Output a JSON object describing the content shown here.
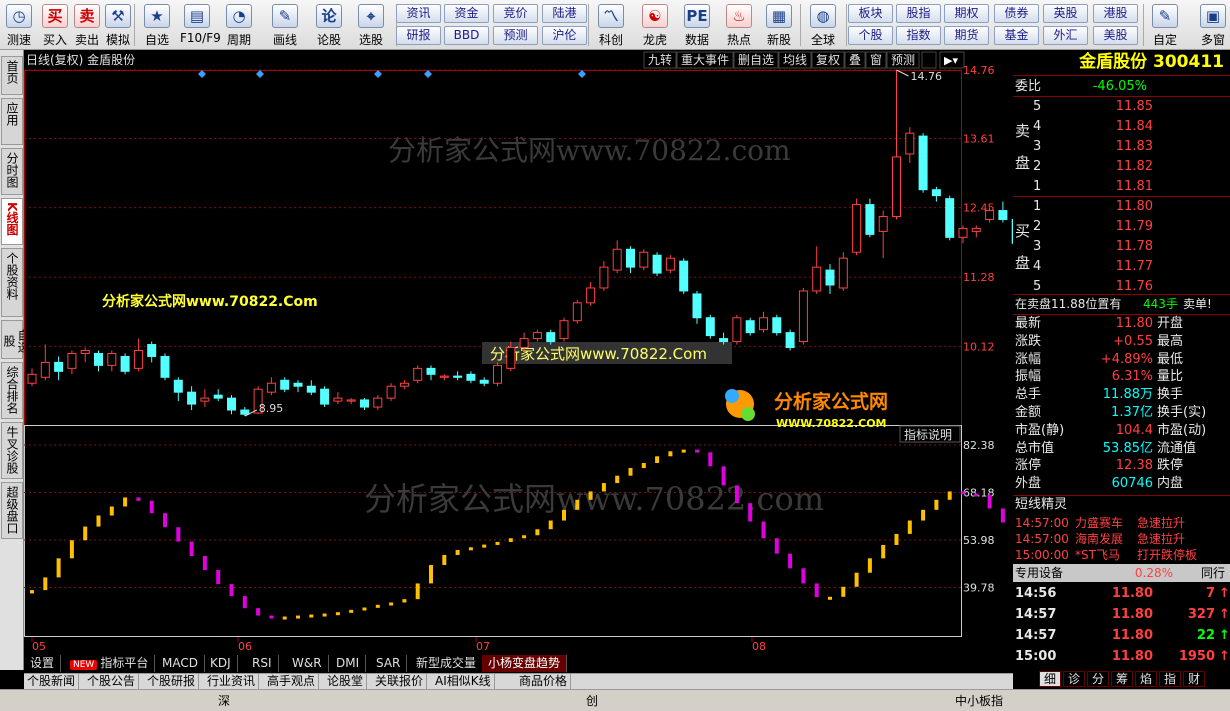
{
  "toolbar": {
    "items": [
      {
        "label": "测速",
        "icon": "clock-icon",
        "glyph": "◷"
      },
      {
        "label": "买入",
        "icon": "buy-icon",
        "glyph": "买"
      },
      {
        "label": "卖出",
        "icon": "sell-icon",
        "glyph": "卖"
      },
      {
        "label": "模拟",
        "icon": "hammer-icon",
        "glyph": "⚒"
      },
      {
        "label": "自选",
        "icon": "star-icon",
        "glyph": "★"
      },
      {
        "label": "F10/F9",
        "icon": "f10-icon",
        "glyph": "▤"
      },
      {
        "label": "周期",
        "icon": "period-icon",
        "glyph": "◔"
      },
      {
        "label": "画线",
        "icon": "pen-icon",
        "glyph": "✎"
      },
      {
        "label": "论股",
        "icon": "discuss-icon",
        "glyph": "论"
      },
      {
        "label": "选股",
        "icon": "stock-pick-icon",
        "glyph": "⌖"
      },
      {
        "label": "科创",
        "icon": "kechuang-icon",
        "glyph": "〽"
      },
      {
        "label": "龙虎",
        "icon": "dragon-icon",
        "glyph": "☯"
      },
      {
        "label": "数据",
        "icon": "pe-icon",
        "glyph": "PE"
      },
      {
        "label": "热点",
        "icon": "hot-icon",
        "glyph": "♨"
      },
      {
        "label": "新股",
        "icon": "new-stock-icon",
        "glyph": "▦"
      },
      {
        "label": "全球",
        "icon": "globe-icon",
        "glyph": "◍"
      },
      {
        "label": "自定",
        "icon": "custom-icon",
        "glyph": "✎"
      },
      {
        "label": "多窗",
        "icon": "multiwindow-icon",
        "glyph": "▣"
      }
    ],
    "buttons_top": [
      "资讯",
      "资金",
      "竞价",
      "陆港",
      "板块",
      "股指",
      "期权",
      "债券",
      "英股",
      "港股"
    ],
    "buttons_bottom": [
      "研报",
      "BBD",
      "预测",
      "沪伦",
      "个股",
      "指数",
      "期货",
      "基金",
      "外汇",
      "美股"
    ]
  },
  "leftnav": [
    "首页",
    "应用",
    "分时图",
    "K线图",
    "个股资料",
    "自选股",
    "综合排名",
    "牛叉诊股",
    "超级盘口"
  ],
  "chart": {
    "title": "日线(复权) 金盾股份",
    "menu": [
      "九转",
      "重大事件",
      "删自选",
      "均线",
      "复权",
      "叠",
      "窗",
      "预测"
    ],
    "price_labels": [
      "14.76",
      "13.61",
      "12.45",
      "11.28",
      "10.12"
    ],
    "high_label": "14.76",
    "low_label": "8.95",
    "indicator_labels": [
      "82.38",
      "68.18",
      "53.98",
      "39.78"
    ],
    "indicator_btn": "指标说明",
    "x_labels": [
      "05",
      "06",
      "07",
      "08"
    ],
    "watermark": "分析家公式网www.70822.com",
    "watermark_yellow": "分析家公式网www.70822.Com",
    "watermark_box": "分析家公式网www.70822.Com",
    "logo_text": "分析家公式网",
    "logo_url": "WWW.70822.COM"
  },
  "chart_data": {
    "type": "candlestick",
    "price_range": [
      8.95,
      14.76
    ],
    "indicator_range": [
      25.58,
      82.38
    ],
    "candles": [
      {
        "o": 9.5,
        "c": 9.65,
        "h": 9.75,
        "l": 9.45
      },
      {
        "o": 9.6,
        "c": 9.85,
        "h": 10.15,
        "l": 9.55
      },
      {
        "o": 9.85,
        "c": 9.7,
        "h": 9.95,
        "l": 9.55
      },
      {
        "o": 9.75,
        "c": 10.0,
        "h": 10.05,
        "l": 9.65
      },
      {
        "o": 10.0,
        "c": 10.05,
        "h": 10.1,
        "l": 9.85
      },
      {
        "o": 10.0,
        "c": 9.8,
        "h": 10.05,
        "l": 9.7
      },
      {
        "o": 9.8,
        "c": 10.0,
        "h": 10.05,
        "l": 9.7
      },
      {
        "o": 9.95,
        "c": 9.7,
        "h": 10.0,
        "l": 9.65
      },
      {
        "o": 9.75,
        "c": 10.05,
        "h": 10.25,
        "l": 9.7
      },
      {
        "o": 10.15,
        "c": 9.95,
        "h": 10.2,
        "l": 9.85
      },
      {
        "o": 9.95,
        "c": 9.6,
        "h": 10.0,
        "l": 9.55
      },
      {
        "o": 9.55,
        "c": 9.35,
        "h": 9.6,
        "l": 9.2
      },
      {
        "o": 9.35,
        "c": 9.15,
        "h": 9.45,
        "l": 9.05
      },
      {
        "o": 9.2,
        "c": 9.25,
        "h": 9.4,
        "l": 9.1
      },
      {
        "o": 9.3,
        "c": 9.25,
        "h": 9.4,
        "l": 9.2
      },
      {
        "o": 9.25,
        "c": 9.05,
        "h": 9.3,
        "l": 8.98
      },
      {
        "o": 9.05,
        "c": 8.98,
        "h": 9.1,
        "l": 8.95
      },
      {
        "o": 9.0,
        "c": 9.4,
        "h": 9.45,
        "l": 8.98
      },
      {
        "o": 9.35,
        "c": 9.5,
        "h": 9.6,
        "l": 9.3
      },
      {
        "o": 9.55,
        "c": 9.4,
        "h": 9.6,
        "l": 9.35
      },
      {
        "o": 9.5,
        "c": 9.45,
        "h": 9.55,
        "l": 9.35
      },
      {
        "o": 9.45,
        "c": 9.35,
        "h": 9.55,
        "l": 9.3
      },
      {
        "o": 9.4,
        "c": 9.15,
        "h": 9.45,
        "l": 9.1
      },
      {
        "o": 9.2,
        "c": 9.25,
        "h": 9.35,
        "l": 9.15
      },
      {
        "o": 9.2,
        "c": 9.22,
        "h": 9.25,
        "l": 9.15
      },
      {
        "o": 9.22,
        "c": 9.1,
        "h": 9.25,
        "l": 9.05
      },
      {
        "o": 9.1,
        "c": 9.25,
        "h": 9.3,
        "l": 9.05
      },
      {
        "o": 9.25,
        "c": 9.45,
        "h": 9.5,
        "l": 9.2
      },
      {
        "o": 9.45,
        "c": 9.5,
        "h": 9.55,
        "l": 9.4
      },
      {
        "o": 9.55,
        "c": 9.75,
        "h": 9.8,
        "l": 9.5
      },
      {
        "o": 9.75,
        "c": 9.65,
        "h": 9.8,
        "l": 9.55
      },
      {
        "o": 9.6,
        "c": 9.62,
        "h": 9.65,
        "l": 9.55
      },
      {
        "o": 9.62,
        "c": 9.6,
        "h": 9.7,
        "l": 9.55
      },
      {
        "o": 9.65,
        "c": 9.55,
        "h": 9.7,
        "l": 9.5
      },
      {
        "o": 9.55,
        "c": 9.5,
        "h": 9.6,
        "l": 9.45
      },
      {
        "o": 9.5,
        "c": 9.8,
        "h": 9.85,
        "l": 9.45
      },
      {
        "o": 9.75,
        "c": 10.1,
        "h": 10.2,
        "l": 9.7
      },
      {
        "o": 10.1,
        "c": 10.25,
        "h": 10.35,
        "l": 10.05
      },
      {
        "o": 10.25,
        "c": 10.35,
        "h": 10.4,
        "l": 10.2
      },
      {
        "o": 10.35,
        "c": 10.2,
        "h": 10.4,
        "l": 10.15
      },
      {
        "o": 10.25,
        "c": 10.55,
        "h": 10.6,
        "l": 10.2
      },
      {
        "o": 10.55,
        "c": 10.85,
        "h": 10.9,
        "l": 10.5
      },
      {
        "o": 10.85,
        "c": 11.1,
        "h": 11.2,
        "l": 10.8
      },
      {
        "o": 11.1,
        "c": 11.45,
        "h": 11.55,
        "l": 11.05
      },
      {
        "o": 11.4,
        "c": 11.75,
        "h": 11.9,
        "l": 11.35
      },
      {
        "o": 11.75,
        "c": 11.45,
        "h": 11.8,
        "l": 11.35
      },
      {
        "o": 11.45,
        "c": 11.7,
        "h": 11.75,
        "l": 11.4
      },
      {
        "o": 11.65,
        "c": 11.35,
        "h": 11.7,
        "l": 11.3
      },
      {
        "o": 11.4,
        "c": 11.6,
        "h": 11.65,
        "l": 11.35
      },
      {
        "o": 11.55,
        "c": 11.05,
        "h": 11.6,
        "l": 11.0
      },
      {
        "o": 11.0,
        "c": 10.6,
        "h": 11.05,
        "l": 10.5
      },
      {
        "o": 10.6,
        "c": 10.3,
        "h": 10.65,
        "l": 10.25
      },
      {
        "o": 10.25,
        "c": 10.2,
        "h": 10.35,
        "l": 10.15
      },
      {
        "o": 10.2,
        "c": 10.6,
        "h": 10.65,
        "l": 10.15
      },
      {
        "o": 10.55,
        "c": 10.35,
        "h": 10.6,
        "l": 10.3
      },
      {
        "o": 10.4,
        "c": 10.6,
        "h": 10.7,
        "l": 10.35
      },
      {
        "o": 10.6,
        "c": 10.35,
        "h": 10.65,
        "l": 10.3
      },
      {
        "o": 10.35,
        "c": 10.1,
        "h": 10.4,
        "l": 10.05
      },
      {
        "o": 10.2,
        "c": 11.05,
        "h": 11.1,
        "l": 10.15
      },
      {
        "o": 11.05,
        "c": 11.45,
        "h": 11.8,
        "l": 11.0
      },
      {
        "o": 11.4,
        "c": 11.15,
        "h": 11.5,
        "l": 11.0
      },
      {
        "o": 11.1,
        "c": 11.6,
        "h": 11.7,
        "l": 11.05
      },
      {
        "o": 11.7,
        "c": 12.5,
        "h": 12.6,
        "l": 11.65
      },
      {
        "o": 12.5,
        "c": 12.0,
        "h": 12.6,
        "l": 11.95
      },
      {
        "o": 12.05,
        "c": 12.3,
        "h": 12.4,
        "l": 11.6
      },
      {
        "o": 12.3,
        "c": 13.3,
        "h": 14.76,
        "l": 12.25
      },
      {
        "o": 13.35,
        "c": 13.7,
        "h": 13.8,
        "l": 13.2
      },
      {
        "o": 13.65,
        "c": 12.75,
        "h": 13.7,
        "l": 12.7
      },
      {
        "o": 12.75,
        "c": 12.65,
        "h": 12.8,
        "l": 12.55
      },
      {
        "o": 12.6,
        "c": 11.95,
        "h": 12.65,
        "l": 11.9
      },
      {
        "o": 11.95,
        "c": 12.1,
        "h": 12.15,
        "l": 11.85
      },
      {
        "o": 12.05,
        "c": 12.1,
        "h": 12.15,
        "l": 11.95
      },
      {
        "o": 12.25,
        "c": 12.4,
        "h": 12.45,
        "l": 12.2
      },
      {
        "o": 12.4,
        "c": 12.25,
        "h": 12.55,
        "l": 12.2
      },
      {
        "o": 12.25,
        "c": 11.85,
        "h": 12.3,
        "l": 11.8
      },
      {
        "o": 11.8,
        "c": 11.55,
        "h": 11.85,
        "l": 11.45
      },
      {
        "o": 11.5,
        "c": 11.9,
        "h": 11.95,
        "l": 11.45
      }
    ],
    "indicator": [
      39.0,
      42.8,
      48.5,
      53.9,
      58.0,
      61.3,
      64.0,
      66.7,
      65.7,
      62.0,
      57.8,
      53.5,
      49.2,
      45.0,
      40.8,
      37.2,
      33.6,
      31.4,
      31.1,
      31.1,
      31.4,
      31.7,
      32.0,
      32.4,
      33.1,
      33.8,
      34.6,
      35.3,
      36.3,
      41.0,
      46.5,
      49.5,
      51.0,
      51.8,
      52.6,
      53.4,
      54.5,
      55.4,
      57.2,
      59.8,
      63.0,
      66.0,
      68.5,
      71.0,
      73.2,
      75.5,
      77.0,
      79.0,
      80.5,
      81.0,
      80.2,
      76.0,
      70.3,
      65.0,
      59.5,
      54.5,
      49.9,
      45.5,
      41.0,
      36.9,
      37.0,
      40.0,
      44.2,
      48.5,
      52.5,
      55.8,
      59.8,
      63.0,
      66.0,
      68.5,
      67.9,
      67.5,
      63.4,
      59.2,
      55.0,
      51.0,
      46.9,
      42.7,
      38.5,
      35.0
    ],
    "indicator_rising_color": "#ffc000",
    "indicator_falling_color": "#e000e0",
    "up_color": "#ff4040",
    "down_color": "#54ffff"
  },
  "quote": {
    "title": "金盾股份 300411",
    "weibi_label": "委比",
    "weibi": "-46.05%",
    "sell_label": [
      "卖",
      "盘"
    ],
    "buy_label": [
      "买",
      "盘"
    ],
    "sell": [
      {
        "n": "5",
        "p": "11.85"
      },
      {
        "n": "4",
        "p": "11.84"
      },
      {
        "n": "3",
        "p": "11.83"
      },
      {
        "n": "2",
        "p": "11.82"
      },
      {
        "n": "1",
        "p": "11.81"
      }
    ],
    "buy": [
      {
        "n": "1",
        "p": "11.80"
      },
      {
        "n": "2",
        "p": "11.79"
      },
      {
        "n": "3",
        "p": "11.78"
      },
      {
        "n": "4",
        "p": "11.77"
      },
      {
        "n": "5",
        "p": "11.76"
      }
    ],
    "notice": "在卖盘11.88位置有",
    "notice_qty": "443手",
    "notice_tag": "卖单!",
    "stats": [
      {
        "l": "最新",
        "v": "11.80",
        "r": "开盘"
      },
      {
        "l": "涨跌",
        "v": "+0.55",
        "r": "最高"
      },
      {
        "l": "涨幅",
        "v": "+4.89%",
        "r": "最低"
      },
      {
        "l": "振幅",
        "v": "6.31%",
        "r": "量比"
      },
      {
        "l": "总手",
        "v": "11.88万",
        "r": "换手"
      },
      {
        "l": "金额",
        "v": "1.37亿",
        "r": "换手(实)"
      },
      {
        "l": "市盈(静)",
        "v": "104.4",
        "r": "市盈(动)"
      },
      {
        "l": "总市值",
        "v": "53.85亿",
        "r": "流通值"
      },
      {
        "l": "涨停",
        "v": "12.38",
        "r": "跌停"
      },
      {
        "l": "外盘",
        "v": "60746",
        "r": "内盘"
      }
    ],
    "sprite_title": "短线精灵",
    "sprite": [
      {
        "t": "14:57:00",
        "n": "力盛赛车",
        "e": "急速拉升"
      },
      {
        "t": "14:57:00",
        "n": "海南发展",
        "e": "急速拉升"
      },
      {
        "t": "15:00:00",
        "n": "*ST飞马",
        "e": "打开跌停板"
      }
    ],
    "sector_name": "专用设备",
    "sector_pct": "0.28%",
    "sector_more": "同行",
    "ticks": [
      {
        "t": "14:56",
        "p": "11.80",
        "v": "7",
        "c": "red"
      },
      {
        "t": "14:57",
        "p": "11.80",
        "v": "327",
        "c": "red"
      },
      {
        "t": "14:57",
        "p": "11.80",
        "v": "22",
        "c": "grn"
      },
      {
        "t": "15:00",
        "p": "11.80",
        "v": "1950",
        "c": "red"
      }
    ],
    "right_tabs": [
      "细",
      "诊",
      "分",
      "筹",
      "焰",
      "指",
      "财"
    ]
  },
  "bottom_tabs": [
    "设置",
    "指标平台",
    "MACD",
    "KDJ",
    "RSI",
    "W&R",
    "DMI",
    "SAR",
    "新型成交量",
    "小杨变盘趋势"
  ],
  "new_badge": "NEW",
  "news_tabs": [
    "个股新闻",
    "个股公告",
    "个股研报",
    "行业资讯",
    "高手观点",
    "论股堂",
    "关联报价",
    "AI相似K线",
    "商品价格"
  ],
  "status": {
    "left": "深",
    "mid": "创",
    "right": "中小板指"
  }
}
